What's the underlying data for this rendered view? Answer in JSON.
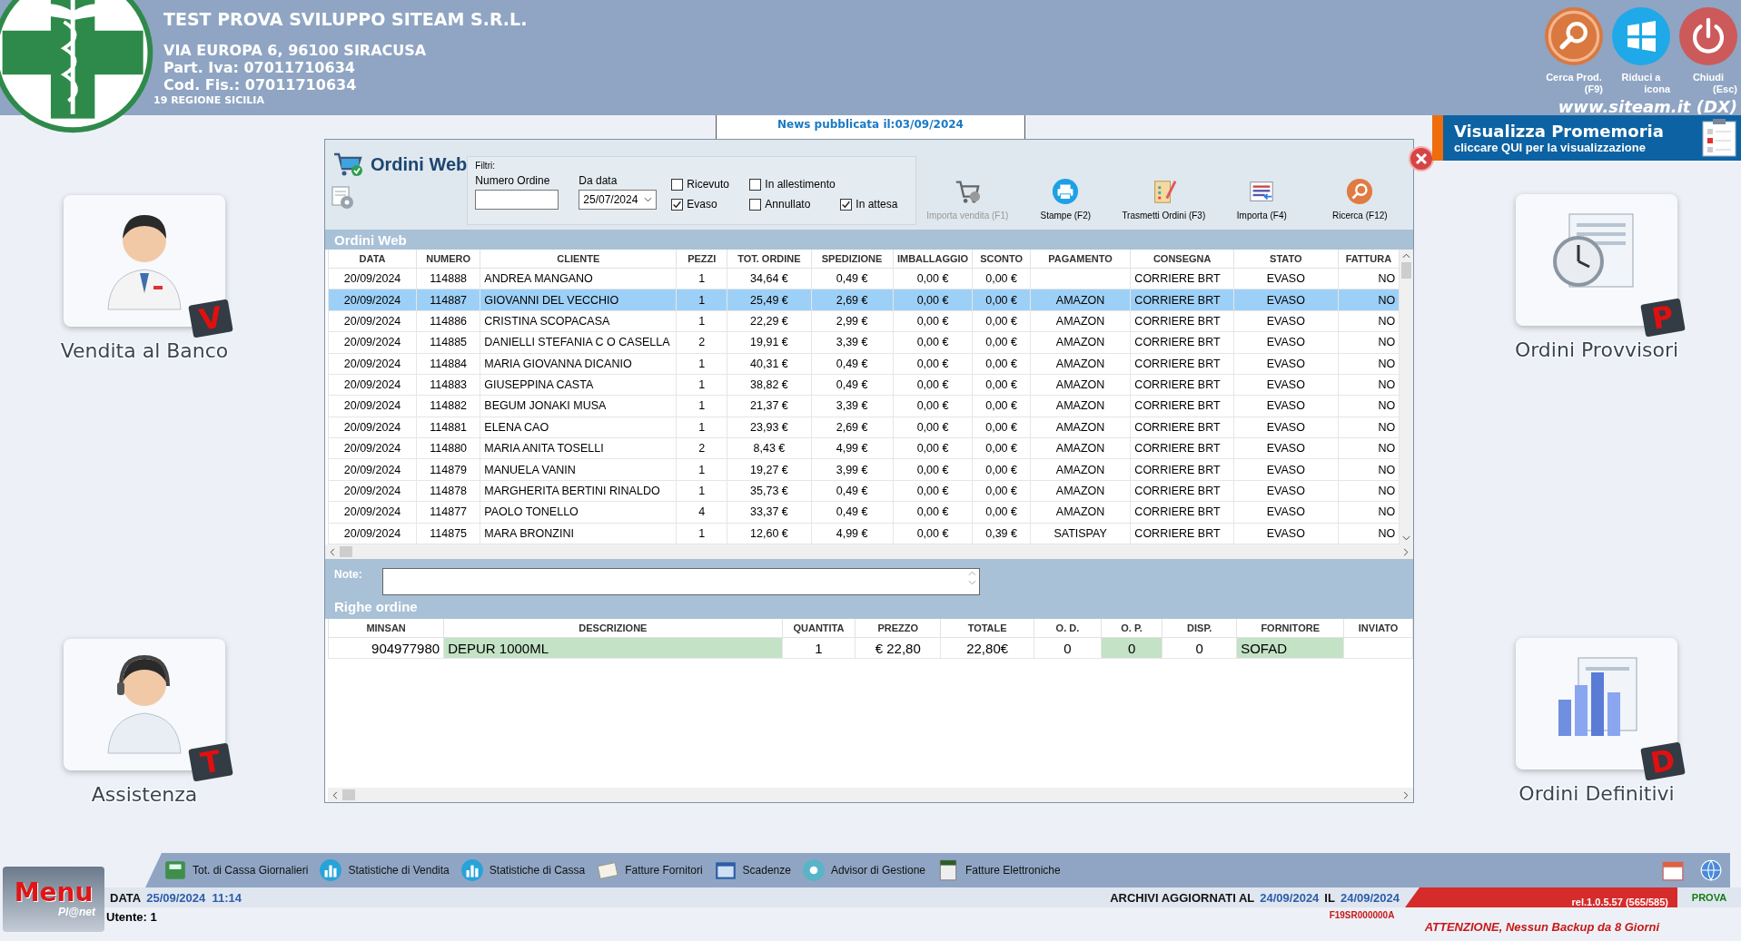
{
  "header": {
    "company": "TEST PROVA SVILUPPO SITEAM S.R.L.",
    "address": "VIA EUROPA 6, 96100 SIRACUSA",
    "vat": "Part. Iva: 07011710634",
    "tax_code": "Cod. Fis.: 07011710634",
    "region": "19 REGIONE SICILIA"
  },
  "top_buttons": [
    {
      "kind": "search",
      "label": "Cerca Prod.",
      "sub": "(F9)"
    },
    {
      "kind": "windows",
      "label": "Riduci a",
      "sub": "icona"
    },
    {
      "kind": "power",
      "label": "Chiudi",
      "sub": "(Esc)"
    }
  ],
  "website": "www.siteam.it (DX)",
  "news": {
    "title": "News pubblicata il:03/09/2024"
  },
  "reminder": {
    "title": "Visualizza Promemoria",
    "subtitle": "cliccare QUI per la visualizzazione"
  },
  "tiles_left": [
    {
      "kind": "doctor",
      "label": "Vendita al Banco",
      "badge": "V"
    },
    {
      "kind": "operator",
      "label": "Assistenza",
      "badge": "T"
    }
  ],
  "tiles_right": [
    {
      "kind": "clock",
      "label": "Ordini Provvisori",
      "badge": "P"
    },
    {
      "kind": "chart",
      "label": "Ordini Definitivi",
      "badge": "D"
    }
  ],
  "dialog": {
    "title": "Ordini Web",
    "filters": {
      "label": "Filtri:",
      "order_number": {
        "label": "Numero Ordine"
      },
      "from_date": {
        "label": "Da data",
        "value": "25/07/2024"
      },
      "checkboxes": [
        {
          "label": "Ricevuto",
          "checked": false
        },
        {
          "label": "Evaso",
          "checked": true
        },
        {
          "label": "In allestimento",
          "checked": false
        },
        {
          "label": "Annullato",
          "checked": false
        },
        {
          "label": "In attesa",
          "checked": true
        }
      ]
    },
    "toolbar": [
      {
        "kind": "cart",
        "label": "Importa vendita (F1)",
        "disabled": true
      },
      {
        "kind": "print",
        "label": "Stampe (F2)",
        "disabled": false
      },
      {
        "kind": "clipboard",
        "label": "Trasmetti Ordini (F3)",
        "disabled": false
      },
      {
        "kind": "import",
        "label": "Importa (F4)",
        "disabled": false
      },
      {
        "kind": "search",
        "label": "Ricerca (F12)",
        "disabled": false
      }
    ],
    "orders": {
      "title": "Ordini Web",
      "columns": [
        "DATA",
        "NUMERO",
        "CLIENTE",
        "PEZZI",
        "TOT. ORDINE",
        "SPEDIZIONE",
        "IMBALLAGGIO",
        "SCONTO",
        "PAGAMENTO",
        "CONSEGNA",
        "STATO",
        "FATTURA"
      ],
      "rows": [
        {
          "selected": false,
          "cells": [
            "20/09/2024",
            "114888",
            "ANDREA MANGANO",
            "1",
            "34,64 €",
            "0,49 €",
            "0,00 €",
            "0,00 €",
            null,
            "CORRIERE BRT",
            "EVASO",
            "NO"
          ]
        },
        {
          "selected": true,
          "cells": [
            "20/09/2024",
            "114887",
            "GIOVANNI DEL VECCHIO",
            "1",
            "25,49 €",
            "2,69 €",
            "0,00 €",
            "0,00 €",
            "AMAZON",
            "CORRIERE BRT",
            "EVASO",
            "NO"
          ]
        },
        {
          "selected": false,
          "cells": [
            "20/09/2024",
            "114886",
            "CRISTINA SCOPACASA",
            "1",
            "22,29 €",
            "2,99 €",
            "0,00 €",
            "0,00 €",
            "AMAZON",
            "CORRIERE BRT",
            "EVASO",
            "NO"
          ]
        },
        {
          "selected": false,
          "cells": [
            "20/09/2024",
            "114885",
            "DANIELLI STEFANIA C O CASELLA",
            "2",
            "19,91 €",
            "3,39 €",
            "0,00 €",
            "0,00 €",
            "AMAZON",
            "CORRIERE BRT",
            "EVASO",
            "NO"
          ]
        },
        {
          "selected": false,
          "cells": [
            "20/09/2024",
            "114884",
            "MARIA GIOVANNA DICANIO",
            "1",
            "40,31 €",
            "0,49 €",
            "0,00 €",
            "0,00 €",
            "AMAZON",
            "CORRIERE BRT",
            "EVASO",
            "NO"
          ]
        },
        {
          "selected": false,
          "cells": [
            "20/09/2024",
            "114883",
            "GIUSEPPINA CASTA",
            "1",
            "38,82 €",
            "0,49 €",
            "0,00 €",
            "0,00 €",
            "AMAZON",
            "CORRIERE BRT",
            "EVASO",
            "NO"
          ]
        },
        {
          "selected": false,
          "cells": [
            "20/09/2024",
            "114882",
            "BEGUM JONAKI MUSA",
            "1",
            "21,37 €",
            "3,39 €",
            "0,00 €",
            "0,00 €",
            "AMAZON",
            "CORRIERE BRT",
            "EVASO",
            "NO"
          ]
        },
        {
          "selected": false,
          "cells": [
            "20/09/2024",
            "114881",
            "ELENA CAO",
            "1",
            "23,93 €",
            "2,69 €",
            "0,00 €",
            "0,00 €",
            "AMAZON",
            "CORRIERE BRT",
            "EVASO",
            "NO"
          ]
        },
        {
          "selected": false,
          "cells": [
            "20/09/2024",
            "114880",
            "MARIA ANITA TOSELLI",
            "2",
            "8,43 €",
            "4,99 €",
            "0,00 €",
            "0,00 €",
            "AMAZON",
            "CORRIERE BRT",
            "EVASO",
            "NO"
          ]
        },
        {
          "selected": false,
          "cells": [
            "20/09/2024",
            "114879",
            "MANUELA VANIN",
            "1",
            "19,27 €",
            "3,99 €",
            "0,00 €",
            "0,00 €",
            "AMAZON",
            "CORRIERE BRT",
            "EVASO",
            "NO"
          ]
        },
        {
          "selected": false,
          "cells": [
            "20/09/2024",
            "114878",
            "MARGHERITA BERTINI RINALDO",
            "1",
            "35,73 €",
            "0,49 €",
            "0,00 €",
            "0,00 €",
            "AMAZON",
            "CORRIERE BRT",
            "EVASO",
            "NO"
          ]
        },
        {
          "selected": false,
          "cells": [
            "20/09/2024",
            "114877",
            "PAOLO TONELLO",
            "4",
            "33,37 €",
            "0,49 €",
            "0,00 €",
            "0,00 €",
            "AMAZON",
            "CORRIERE BRT",
            "EVASO",
            "NO"
          ]
        },
        {
          "selected": false,
          "cells": [
            "20/09/2024",
            "114875",
            "MARA BRONZINI",
            "1",
            "12,60 €",
            "4,99 €",
            "0,00 €",
            "0,39 €",
            "SATISPAY",
            "CORRIERE BRT",
            "EVASO",
            "NO"
          ]
        }
      ]
    },
    "notes": {
      "label": "Note:"
    },
    "lines": {
      "title": "Righe ordine",
      "columns": [
        {
          "label": "MINSAN",
          "highlighted": false
        },
        {
          "label": "DESCRIZIONE",
          "highlighted": true
        },
        {
          "label": "QUANTITA",
          "highlighted": false
        },
        {
          "label": "PREZZO",
          "highlighted": false
        },
        {
          "label": "TOTALE",
          "highlighted": false
        },
        {
          "label": "O. D.",
          "highlighted": false
        },
        {
          "label": "O. P.",
          "highlighted": true
        },
        {
          "label": "DISP.",
          "highlighted": false
        },
        {
          "label": "FORNITORE",
          "highlighted": true
        },
        {
          "label": "INVIATO",
          "highlighted": false
        }
      ],
      "rows": [
        {
          "cells": [
            "904977980",
            "DEPUR 1000ML",
            "1",
            "€ 22,80",
            "22,80€",
            "0",
            "0",
            "0",
            "SOFAD",
            null
          ]
        }
      ]
    }
  },
  "menu_logo": {
    "title": "Menu",
    "subtitle": "Pl@net"
  },
  "bottom_toolbar": [
    "Tot. di Cassa Giornalieri",
    "Statistiche di Vendita",
    "Statistiche di Cassa",
    "Fatture Fornitori",
    "Scadenze",
    "Advisor di Gestione",
    "Fatture Elettroniche"
  ],
  "status": {
    "date_label": "DATA",
    "date": "25/09/2024  11:14",
    "user": "Utente: 1",
    "archives_label": "ARCHIVI AGGIORNATI AL",
    "archives_date": "24/09/2024",
    "il_label": "IL",
    "il_date": "24/09/2024",
    "release": "rel.1.0.5.57 (565/585)",
    "code": "F19SR000000A",
    "warning": "ATTENZIONE, Nessun Backup da 8 Giorni",
    "mode": "PROVA"
  }
}
